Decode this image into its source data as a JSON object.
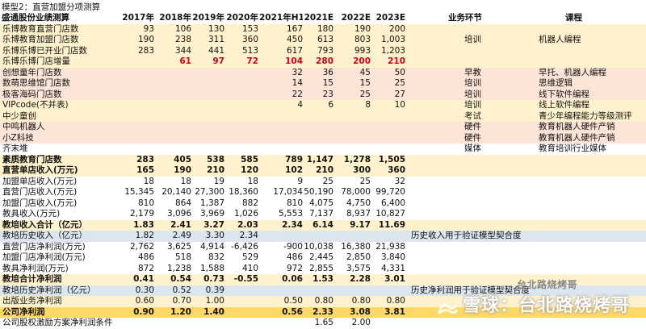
{
  "title": "模型2：直营加盟分项测算",
  "headers": {
    "section": "盛通股份业绩测算",
    "years": [
      "2017年",
      "2018年",
      "2019年",
      "2020年",
      "2021年H1",
      "2021E",
      "2022E",
      "2023E"
    ],
    "biz": "业务环节",
    "course": "课程"
  },
  "rows": [
    {
      "label": "乐博教育直营门店数",
      "values": [
        "93",
        "106",
        "130",
        "153",
        "167",
        "180",
        "190",
        "200"
      ],
      "biz": "",
      "course": "",
      "bg": "#fff2cc"
    },
    {
      "label": "乐博教育加盟门店数",
      "values": [
        "190",
        "238",
        "311",
        "360",
        "450",
        "613",
        "803",
        "1,003"
      ],
      "biz": "培训",
      "course": "机器人编程",
      "bg": "#fff2cc"
    },
    {
      "label": "乐博乐博已开业门店数",
      "values": [
        "283",
        "344",
        "441",
        "513",
        "617",
        "793",
        "993",
        "1,203"
      ],
      "biz": "",
      "course": "",
      "bg": "#fff2cc"
    },
    {
      "label": "乐博乐博门店增量",
      "values": [
        "",
        "61",
        "97",
        "72",
        "104",
        "280",
        "200",
        "210"
      ],
      "biz": "",
      "course": "",
      "bg": "#fff2cc",
      "style": "red"
    },
    {
      "label": "创想童年门店数",
      "values": [
        "",
        "",
        "",
        "",
        "32",
        "36",
        "45",
        "50"
      ],
      "biz": "早教",
      "course": "早托、机器人编程",
      "bg": "#fce4d6"
    },
    {
      "label": "数萌思维馆门店数",
      "values": [
        "",
        "",
        "",
        "",
        "14",
        "15",
        "15",
        "25"
      ],
      "biz": "培训",
      "course": "思维逻辑",
      "bg": "#fce4d6"
    },
    {
      "label": "极客海码门店数",
      "values": [
        "",
        "",
        "",
        "",
        "22",
        "23",
        "25",
        "27"
      ],
      "biz": "培训",
      "course": "线下软件编程",
      "bg": "#fce4d6"
    },
    {
      "label": "VIPcode(不并表)",
      "values": [
        "",
        "",
        "",
        "",
        "4",
        "6",
        "8",
        "10"
      ],
      "biz": "培训",
      "course": "线上软件编程",
      "bg": "#fff2cc"
    },
    {
      "label": "中少童创",
      "values": [
        "",
        "",
        "",
        "",
        "",
        "",
        "",
        ""
      ],
      "biz": "考试",
      "course": "青少年编程能力等级测评",
      "bg": "#fff2cc"
    },
    {
      "label": "中鸣机器人",
      "values": [
        "",
        "",
        "",
        "",
        "",
        "",
        "",
        ""
      ],
      "biz": "硬件",
      "course": "教育机器人硬件产销",
      "bg": "#fce4d6"
    },
    {
      "label": "小Z科技",
      "values": [
        "",
        "",
        "",
        "",
        "",
        "",
        "",
        ""
      ],
      "biz": "硬件",
      "course": "教育机器人硬件产销",
      "bg": "#fce4d6"
    },
    {
      "label": "齐末堆",
      "values": [
        "",
        "",
        "",
        "",
        "",
        "",
        "",
        ""
      ],
      "biz": "媒体",
      "course": "教育培训行业媒体",
      "bg": "#ffffff"
    },
    {
      "label": "素质教育门店数",
      "values": [
        "283",
        "405",
        "538",
        "585",
        "789",
        "1,147",
        "1,278",
        "1,505"
      ],
      "biz": "",
      "course": "",
      "bg": "#fff2cc",
      "style": "b"
    },
    {
      "label": "直营单店收入(万元)",
      "values": [
        "165",
        "190",
        "210",
        "120",
        "102",
        "210",
        "300",
        "360"
      ],
      "biz": "",
      "course": "",
      "bg": "#fff2cc",
      "style": "b"
    },
    {
      "label": "加盟单店收入(万元)",
      "values": [
        "18",
        "18",
        "19",
        "18",
        "9",
        "25",
        "25",
        "32"
      ],
      "biz": "",
      "course": "",
      "bg": "#ffffff"
    },
    {
      "label": "直营门店收入(万元)",
      "values": [
        "15,345",
        "20,140",
        "27,300",
        "18,360",
        "17,034",
        "50,190",
        "78,000",
        "99,720"
      ],
      "biz": "",
      "course": "",
      "bg": "#ffffff"
    },
    {
      "label": "加盟门店收入(万元)",
      "values": [
        "810",
        "864",
        "1,387",
        "882",
        "810",
        "4,075",
        "4,750",
        "6,400"
      ],
      "biz": "",
      "course": "",
      "bg": "#ffffff"
    },
    {
      "label": "教具收入(万元)",
      "values": [
        "2,179",
        "3,096",
        "3,969",
        "1,026",
        "5,553",
        "7,137",
        "8,937",
        "10,827"
      ],
      "biz": "",
      "course": "",
      "bg": "#ffffff"
    },
    {
      "label": "教培收入合计（亿元）",
      "values": [
        "1.83",
        "2.41",
        "3.27",
        "2.03",
        "2.34",
        "6.14",
        "9.17",
        "11.69"
      ],
      "biz": "",
      "course": "",
      "bg": "#fff2cc",
      "style": "b"
    },
    {
      "label": "教培历史收入（亿元）",
      "values": [
        "1.82",
        "2.49",
        "3.30",
        "2.34",
        "",
        "",
        "",
        ""
      ],
      "biz": "历史收入用于验证模型契合度",
      "course": "",
      "bg": "#dce6f1"
    },
    {
      "label": "直营门店净利润(万元)",
      "values": [
        "2,762",
        "3,625",
        "4,914",
        "-6,426",
        "-900",
        "10,038",
        "16,380",
        "21,938"
      ],
      "biz": "",
      "course": "",
      "bg": "#ffffff"
    },
    {
      "label": "加盟门店净利润(万元)",
      "values": [
        "486",
        "518",
        "832",
        "529",
        "486",
        "2,445",
        "2,850",
        "3,840"
      ],
      "biz": "",
      "course": "",
      "bg": "#ffffff"
    },
    {
      "label": "教具净利润(万元)",
      "values": [
        "872",
        "1,238",
        "1,588",
        "410",
        "972",
        "2,855",
        "3,575",
        "4,331"
      ],
      "biz": "",
      "course": "",
      "bg": "#ffffff"
    },
    {
      "label": "教培合计净利润",
      "values": [
        "0.41",
        "0.54",
        "0.73",
        "-0.55",
        "0.06",
        "1.53",
        "2.28",
        "3.01"
      ],
      "biz": "",
      "course": "",
      "bg": "#fff2cc",
      "style": "b"
    },
    {
      "label": "教培历史净利润（亿元）",
      "values": [
        "0.30",
        "0.52",
        "0.39",
        "",
        "",
        "",
        "",
        ""
      ],
      "biz": "历史净利润用于验证模型契合度",
      "course": "",
      "bg": "#dce6f1"
    },
    {
      "label": "出版业务净利润",
      "values": [
        "0.60",
        "0.70",
        "1.00",
        "",
        "0.50",
        "0.80",
        "0.80",
        "0.80"
      ],
      "biz": "",
      "course": "",
      "bg": "#fff2cc"
    },
    {
      "label": "公司净利润",
      "values": [
        "0.90",
        "1.20",
        "1.40",
        "",
        "0.56",
        "2.33",
        "3.08",
        "3.81"
      ],
      "biz": "",
      "course": "",
      "bg": "#ffd966",
      "style": "b"
    },
    {
      "label": "公司股权激励方案净利润条件",
      "values": [
        "",
        "",
        "",
        "",
        "",
        "1.65",
        "2.00",
        ""
      ],
      "biz": "",
      "course": "",
      "bg": "#ffffff"
    }
  ],
  "watermark": {
    "main": "雪球：台北路烧烤哥",
    "sub": "台北路烧烤哥"
  }
}
